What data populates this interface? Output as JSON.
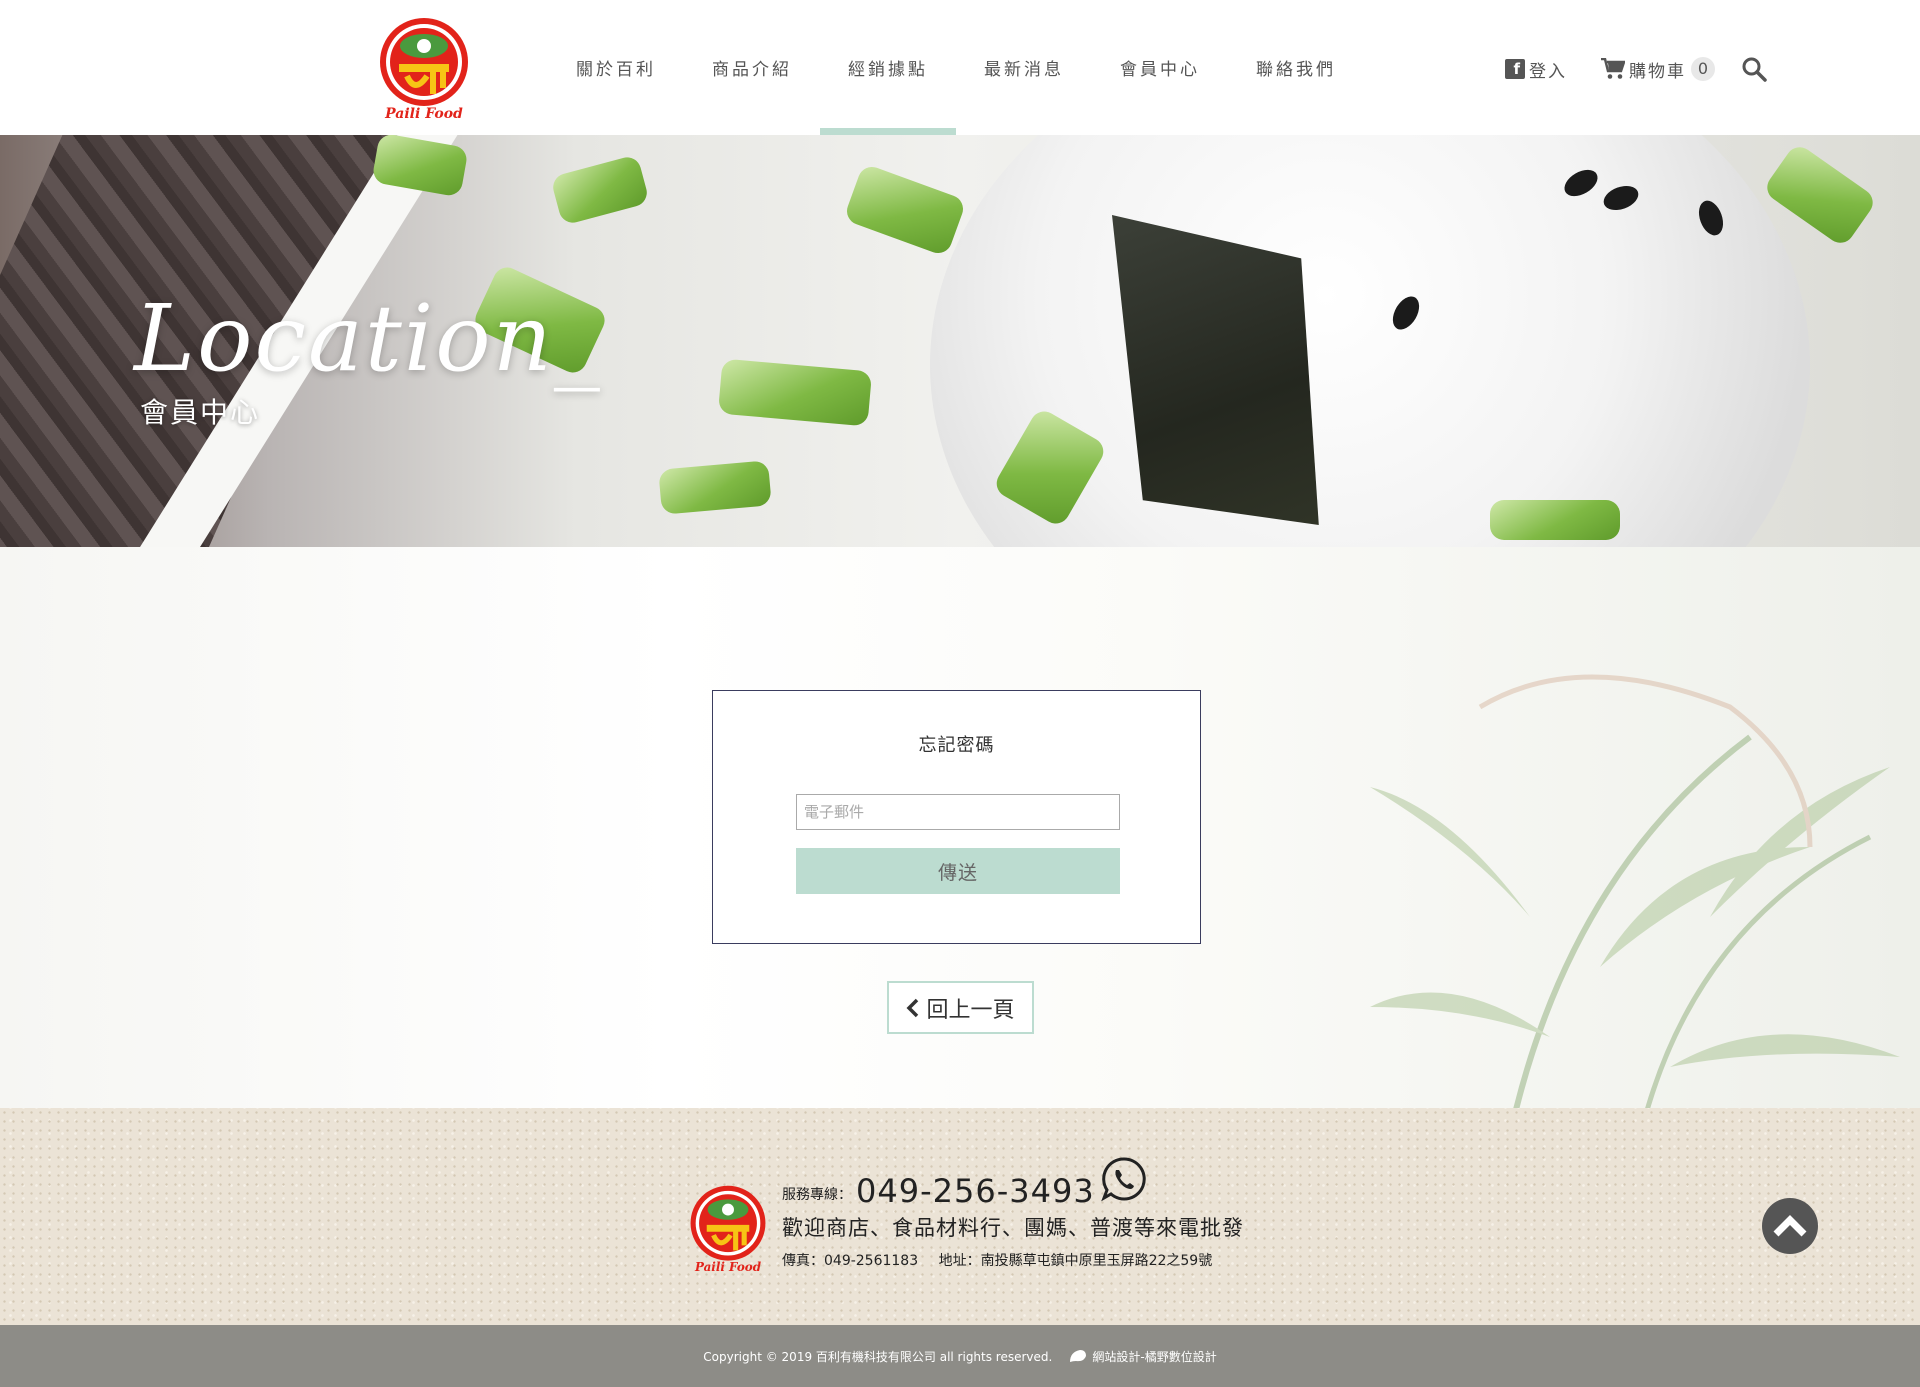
{
  "header": {
    "logo_text": "Paili Food",
    "nav": [
      {
        "label": "關於百利"
      },
      {
        "label": "商品介紹"
      },
      {
        "label": "經銷據點"
      },
      {
        "label": "最新消息"
      },
      {
        "label": "會員中心"
      },
      {
        "label": "聯絡我們"
      }
    ],
    "active_nav_index": 2,
    "login_label": "登入",
    "cart_label": "購物車",
    "cart_count": "0",
    "accent_color": "#bcdcd0"
  },
  "banner": {
    "title": "Location_",
    "subtitle": "會員中心"
  },
  "form": {
    "title": "忘記密碼",
    "email_placeholder": "電子郵件",
    "email_value": "",
    "submit_label": "傳送"
  },
  "back_label": "回上一頁",
  "footer": {
    "logo_text": "Paili Food",
    "service_label": "服務專線：",
    "phone": "049-256-3493",
    "tagline": "歡迎商店、食品材料行、團媽、普渡等來電批發",
    "fax": "傳真：049-2561183",
    "address": "地址：南投縣草屯鎮中原里玉屏路22之59號"
  },
  "copyright": {
    "text": "Copyright © 2019 百利有機科技有限公司 all rights reserved.",
    "designer": "網站設計-橘野數位設計"
  }
}
